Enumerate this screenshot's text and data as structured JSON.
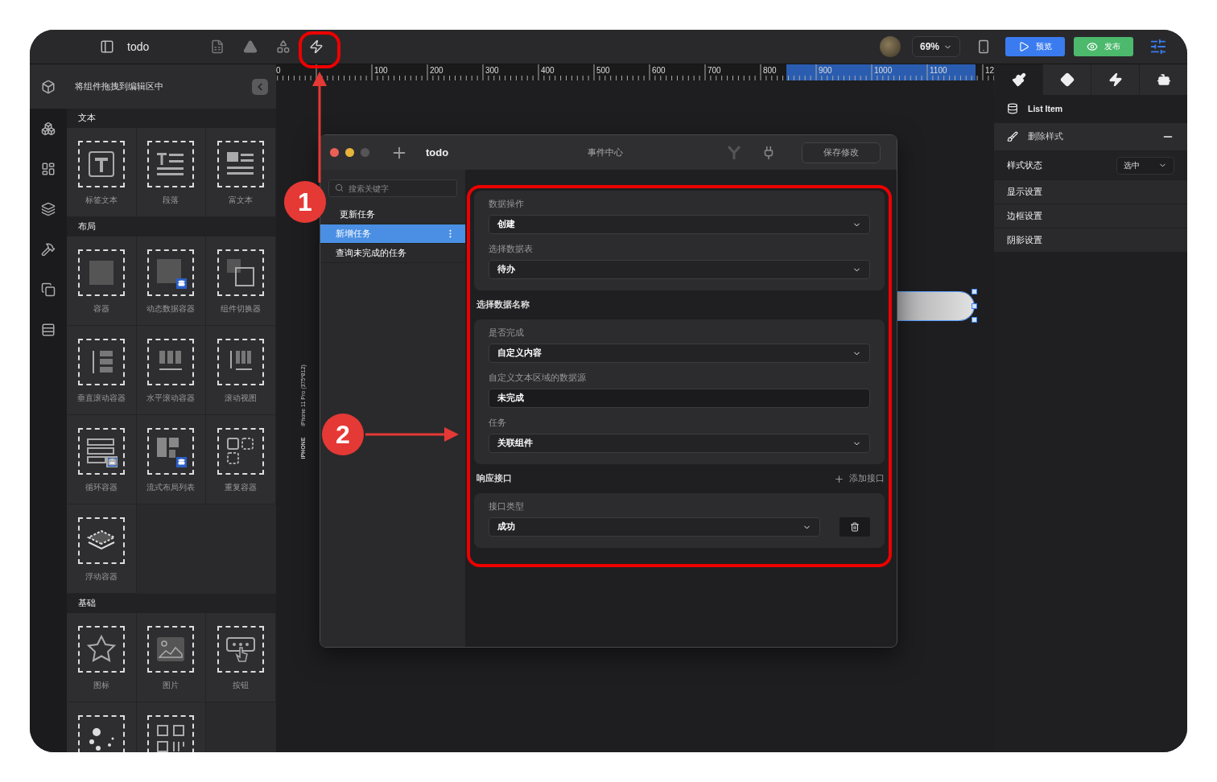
{
  "toolbar": {
    "title": "todo",
    "zoom": "69%",
    "preview_button": "预览",
    "publish_button": "发布"
  },
  "rail": {
    "items": [
      {
        "selected": true
      },
      {
        "selected": false
      },
      {
        "selected": false
      },
      {
        "selected": false
      },
      {
        "selected": false
      },
      {
        "selected": false
      },
      {
        "selected": false
      }
    ]
  },
  "components_panel": {
    "title": "将组件拖拽到编辑区中",
    "sections": [
      {
        "title": "文本",
        "items": [
          {
            "kind": "component",
            "label": "标签文本"
          },
          {
            "kind": "component",
            "label": "段落"
          },
          {
            "kind": "component",
            "label": "富文本"
          }
        ]
      },
      {
        "title": "布局",
        "items": [
          {
            "kind": "component",
            "label": "容器"
          },
          {
            "kind": "component",
            "label": "动态数据容器"
          },
          {
            "kind": "component",
            "label": "组件切换器"
          },
          {
            "kind": "component",
            "label": "垂直滚动容器"
          },
          {
            "kind": "component",
            "label": "水平滚动容器"
          },
          {
            "kind": "component",
            "label": "滚动视图"
          },
          {
            "kind": "component",
            "label": "循环容器"
          },
          {
            "kind": "component",
            "label": "流式布局列表"
          },
          {
            "kind": "component",
            "label": "重复容器"
          },
          {
            "kind": "component",
            "label": "浮动容器"
          }
        ]
      },
      {
        "title": "基础",
        "items": [
          {
            "kind": "component",
            "label": "图标"
          },
          {
            "kind": "component",
            "label": "图片"
          },
          {
            "kind": "component",
            "label": "按钮"
          },
          {
            "kind": "component"
          },
          {
            "kind": "component"
          }
        ]
      }
    ]
  },
  "ruler": {
    "labels": [
      "0",
      "100",
      "200",
      "300",
      "400",
      "500",
      "600",
      "700",
      "800",
      "900",
      "1000",
      "1100",
      "12"
    ]
  },
  "device": {
    "model": "iPhone 11 Pro (375*812)",
    "label": "IPHONE"
  },
  "event_dialog": {
    "title": "todo",
    "heading": "事件中心",
    "save_button": "保存修改",
    "search": {
      "placeholder": "搜索关键字"
    },
    "events": [
      {
        "label": "更新任务",
        "selected": false
      },
      {
        "label": "新增任务",
        "selected": true
      },
      {
        "label": "查询未完成的任务",
        "selected": false
      }
    ],
    "groups": [
      {
        "fields": [
          {
            "label": "数据操作",
            "kind": "select",
            "value": "创建"
          },
          {
            "label": "选择数据表",
            "kind": "select",
            "value": "待办"
          }
        ]
      },
      {
        "title": "选择数据名称",
        "fields": [
          {
            "label": "是否完成",
            "kind": "select",
            "value": "自定义内容"
          },
          {
            "label": "自定义文本区域的数据源",
            "kind": "input",
            "value": "未完成"
          },
          {
            "label": "任务",
            "kind": "select",
            "value": "关联组件"
          }
        ]
      },
      {
        "title": "响应接口",
        "action": "添加接口",
        "fields": [
          {
            "label": "接口类型",
            "kind": "select",
            "value": "成功",
            "deletable": true
          }
        ]
      }
    ]
  },
  "inspector": {
    "tabs": [
      {
        "selected": true
      },
      {
        "selected": false
      },
      {
        "selected": false
      },
      {
        "selected": false
      }
    ],
    "component": "List Item",
    "style_header": "删除样式",
    "state_label": "样式状态",
    "state_value": "选中",
    "sections": [
      "显示设置",
      "边框设置",
      "阴影设置"
    ]
  },
  "annotations": [
    {
      "label": "1"
    },
    {
      "label": "2"
    }
  ]
}
